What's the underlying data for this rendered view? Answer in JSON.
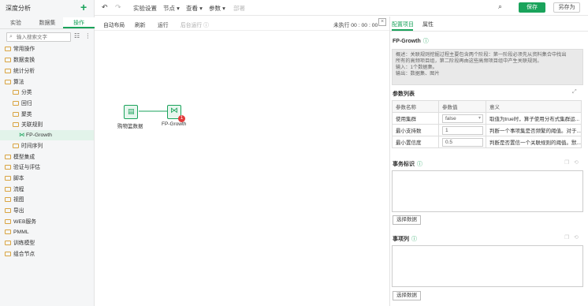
{
  "app": {
    "title": "深度分析",
    "add_label": "+"
  },
  "left_tabs": [
    "实验",
    "数据集",
    "操作"
  ],
  "search": {
    "placeholder": "输入搜索文字"
  },
  "tree": [
    {
      "label": "常用操作",
      "type": "folder"
    },
    {
      "label": "数据变换",
      "type": "folder"
    },
    {
      "label": "统计分析",
      "type": "folder"
    },
    {
      "label": "算法",
      "type": "folder"
    },
    {
      "label": "分类",
      "type": "folder"
    },
    {
      "label": "回归",
      "type": "folder"
    },
    {
      "label": "聚类",
      "type": "folder"
    },
    {
      "label": "关联规则",
      "type": "folder"
    },
    {
      "label": "FP-Growth",
      "type": "algorithm"
    },
    {
      "label": "时间序列",
      "type": "folder"
    },
    {
      "label": "模型集成",
      "type": "folder"
    },
    {
      "label": "验证与评估",
      "type": "folder"
    },
    {
      "label": "脚本",
      "type": "folder"
    },
    {
      "label": "流程",
      "type": "folder"
    },
    {
      "label": "视图",
      "type": "folder"
    },
    {
      "label": "导出",
      "type": "folder"
    },
    {
      "label": "WEB服务",
      "type": "folder"
    },
    {
      "label": "PMML",
      "type": "folder"
    },
    {
      "label": "训练模型",
      "type": "folder"
    },
    {
      "label": "组合节点",
      "type": "folder"
    }
  ],
  "toolbar": {
    "undo": "↶",
    "redo": "↷",
    "menus": [
      "实验设置",
      "节点",
      "查看",
      "参数",
      "部署"
    ],
    "save_label": "保存",
    "saveas_label": "另存为"
  },
  "canvas_bar": {
    "items": [
      "自动布局",
      "刷新",
      "运行",
      "后台运行"
    ],
    "status": "未执行 00 : 00 : 00"
  },
  "nodes": [
    {
      "label": "购物篮数据"
    },
    {
      "label": "FP-Growth",
      "badge": "1"
    }
  ],
  "right": {
    "tabs": [
      "配置项目",
      "属性"
    ],
    "algo_title": "FP-Growth",
    "desc_lines": [
      "概述：关联规则挖掘过程主要包含两个阶段：第一阶段必须先从资料集合中找出",
      "所有的高频项目组，第二阶段再由这些高频项目组中产生关联规则。",
      "输入：1个数据集。",
      "输出：数据集、图片"
    ],
    "params_title": "参数列表",
    "param_headers": [
      "参数名称",
      "参数值",
      "意义"
    ],
    "params": [
      {
        "name": "使用集群",
        "value": "false",
        "meaning": "取值为true时，算子使用分布式集群运..."
      },
      {
        "name": "最小支持数",
        "value": "1",
        "meaning": "判断一个事项集是否频繁的阈值。对于..."
      },
      {
        "name": "最小置信度",
        "value": "0.5",
        "meaning": "判断是否置信一个关联规则的阈值。默..."
      }
    ],
    "transaction_title": "事务标识",
    "item_title": "事项列",
    "select_label": "选择数据"
  }
}
